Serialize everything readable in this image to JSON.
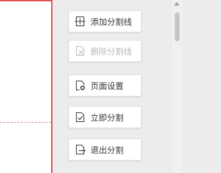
{
  "toolbar": {
    "add_split_line": {
      "label": "添加分割线",
      "icon": "add-split-line-icon",
      "enabled": true
    },
    "delete_split_line": {
      "label": "删除分割线",
      "icon": "delete-split-line-icon",
      "enabled": false
    },
    "page_settings": {
      "label": "页面设置",
      "icon": "page-settings-icon",
      "enabled": true
    },
    "split_now": {
      "label": "立即分割",
      "icon": "split-now-icon",
      "enabled": true
    },
    "exit_split": {
      "label": "退出分割",
      "icon": "exit-split-icon",
      "enabled": true
    }
  },
  "colors": {
    "page_border": "#e05050",
    "split_line": "#d98080",
    "disabled_text": "#b8b8b8"
  }
}
